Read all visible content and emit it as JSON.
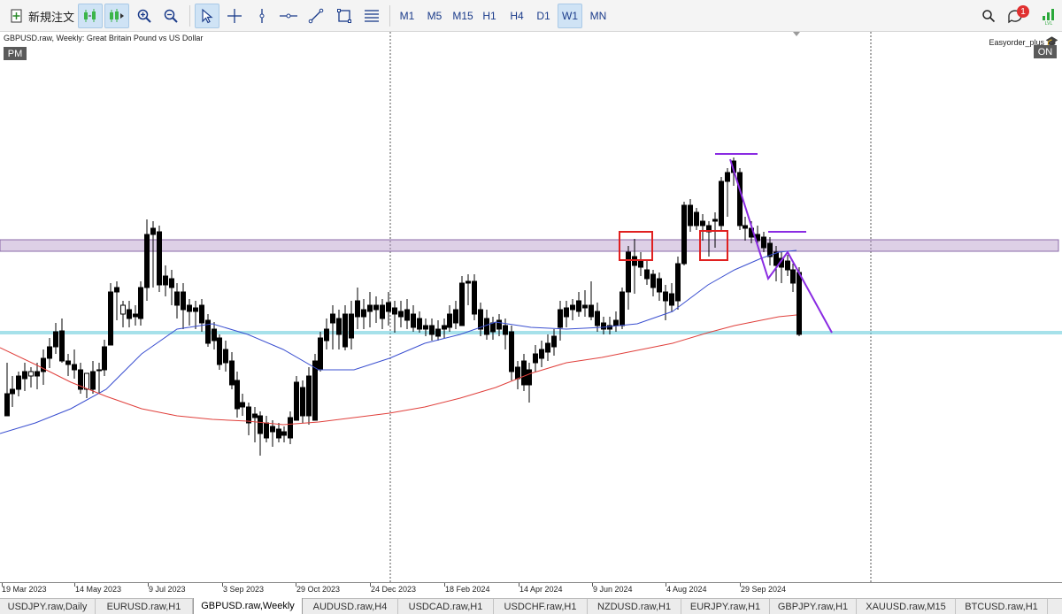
{
  "toolbar": {
    "new_order_label": "新規注文",
    "timeframes": [
      "M1",
      "M5",
      "M15",
      "H1",
      "H4",
      "D1",
      "W1",
      "MN"
    ],
    "active_timeframe": "W1",
    "notification_count": "1"
  },
  "chart": {
    "title": "GBPUSD.raw, Weekly:  Great Britain Pound vs US Dollar",
    "pm_label": "PM",
    "ea_name": "Easyorder_plus",
    "ea_status": "ON",
    "dates": [
      "19 Mar 2023",
      "14 May 2023",
      "9 Jul 2023",
      "3 Sep 2023",
      "29 Oct 2023",
      "24 Dec 2023",
      "18 Feb 2024",
      "14 Apr 2024",
      "9 Jun 2024",
      "4 Aug 2024",
      "29 Sep 2024"
    ],
    "colors": {
      "ma_fast": "#3a4fd0",
      "ma_slow": "#e0403c",
      "resistance_zone": "#b497c8",
      "support_line": "#5cc8d8",
      "trend_lines": "#8a2be2",
      "markers": "#e02020"
    }
  },
  "tabs": [
    "USDJPY.raw,Daily",
    "EURUSD.raw,H1",
    "GBPUSD.raw,Weekly",
    "AUDUSD.raw,H4",
    "USDCAD.raw,H1",
    "USDCHF.raw,H1",
    "NZDUSD.raw,H1",
    "EURJPY.raw,H1",
    "GBPJPY.raw,H1",
    "XAUUSD.raw,M15",
    "BTCUSD.raw,H1"
  ],
  "active_tab": "GBPUSD.raw,Weekly"
}
